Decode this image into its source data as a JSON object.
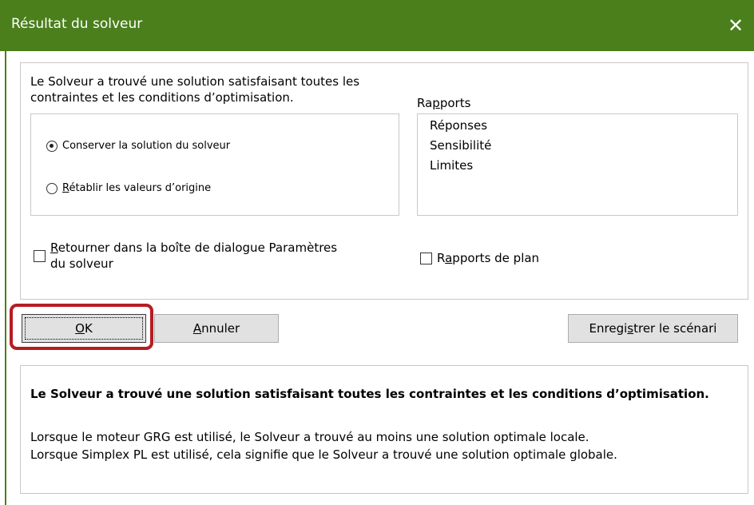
{
  "window": {
    "title": "Résultat du solveur",
    "close_symbol": "✕"
  },
  "message": {
    "line1": "Le Solveur a trouvé une solution satisfaisant toutes les",
    "line2": "contraintes et les conditions d’optimisation."
  },
  "options": {
    "keep": {
      "label": "Conserver la solution du solveur",
      "selected": true
    },
    "restore": {
      "label_underline": "R",
      "label_rest": "établir les valeurs d’origine",
      "selected": false
    }
  },
  "reports": {
    "title_a": "Ra",
    "title_u": "p",
    "title_b": "ports",
    "items": [
      "Réponses",
      "Sensibilité",
      "Limites"
    ]
  },
  "checkboxes": {
    "return_dialog": {
      "line1_u": "R",
      "line1_rest": "etourner dans la boîte de dialogue Paramètres",
      "line2": "du solveur",
      "checked": false
    },
    "plan_reports": {
      "label_a": "R",
      "label_u": "a",
      "label_b": "pports de plan",
      "checked": false
    }
  },
  "buttons": {
    "ok_u": "O",
    "ok_rest": "K",
    "cancel_u": "A",
    "cancel_rest": "nnuler",
    "save_a": "Enregi",
    "save_u": "s",
    "save_b": "trer le scénari"
  },
  "summary": {
    "bold": "Le Solveur a trouvé une solution satisfaisant toutes les contraintes et les conditions d’optimisation.",
    "line1": "Lorsque le moteur GRG est utilisé, le Solveur a trouvé au moins une solution optimale locale.",
    "line2": "Lorsque Simplex PL est utilisé, cela signifie que le Solveur a trouvé une solution optimale globale."
  },
  "colors": {
    "titlebar": "#4a7f1c",
    "highlight": "#b51d23"
  }
}
